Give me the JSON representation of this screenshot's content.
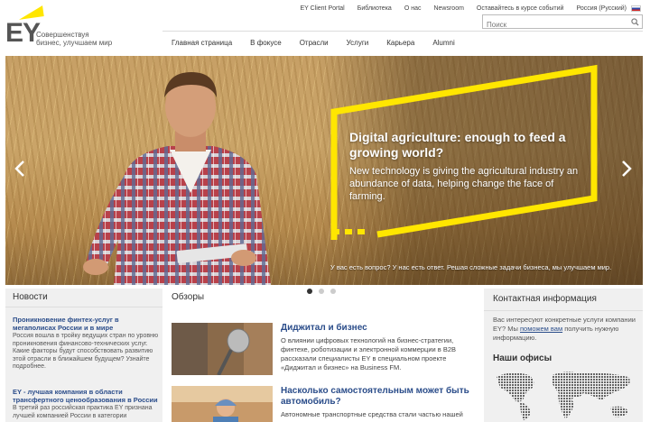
{
  "brand": {
    "logo_text": "EY",
    "tagline": "Совершенствуя бизнес, улучшаем мир"
  },
  "toplinks": [
    {
      "label": "EY Client Portal"
    },
    {
      "label": "Библиотека"
    },
    {
      "label": "О нас"
    },
    {
      "label": "Newsroom"
    },
    {
      "label": "Оставайтесь в курсе событий"
    },
    {
      "label": "Россия (Русский)"
    }
  ],
  "search": {
    "placeholder": "Поиск",
    "icon": "search-icon"
  },
  "nav": [
    {
      "label": "Главная страница"
    },
    {
      "label": "В фокусе"
    },
    {
      "label": "Отрасли"
    },
    {
      "label": "Услуги"
    },
    {
      "label": "Карьера"
    },
    {
      "label": "Alumni"
    }
  ],
  "hero": {
    "title": "Digital agriculture: enough to feed a growing world?",
    "description": "New technology is giving the agricultural industry an abundance of data, helping change the face of farming.",
    "caption": "У вас есть вопрос? У нас есть ответ. Решая сложные задачи бизнеса, мы улучшаем мир.",
    "slides_total": 3,
    "slide_active": 1,
    "accent_color": "#ffe600"
  },
  "news": {
    "heading": "Новости",
    "items": [
      {
        "title": "Проникновение финтех-услуг в мегаполисах России и в мире",
        "text": "Россия вошла в тройку ведущих стран по уровню проникновения финансово-технических услуг. Какие факторы будут способствовать развитию этой отрасли в ближайшем будущем? Узнайте подробнее."
      },
      {
        "title": "EY - лучшая компания в области трансфертного ценообразования в России",
        "text": "В третий раз российская практика EY признана лучшей компанией России в категории"
      }
    ]
  },
  "reviews": {
    "heading": "Обзоры",
    "items": [
      {
        "title": "Диджитал и бизнес",
        "text": "О влиянии цифровых технологий на бизнес-стратегии, финтехе, роботизации и электронной коммерции в B2B рассказали специалисты EY в специальном проекте «Диджитал и бизнес» на Business FM."
      },
      {
        "title": "Насколько самостоятельным может быть автомобиль?",
        "text": "Автономные транспортные средства стали частью нашей"
      }
    ]
  },
  "contact": {
    "heading": "Контактная информация",
    "text_before": "Вас интересуют конкретные услуги компании EY? Мы ",
    "link": "поможем вам",
    "text_after": " получить нужную информацию.",
    "offices_heading": "Наши офисы"
  }
}
